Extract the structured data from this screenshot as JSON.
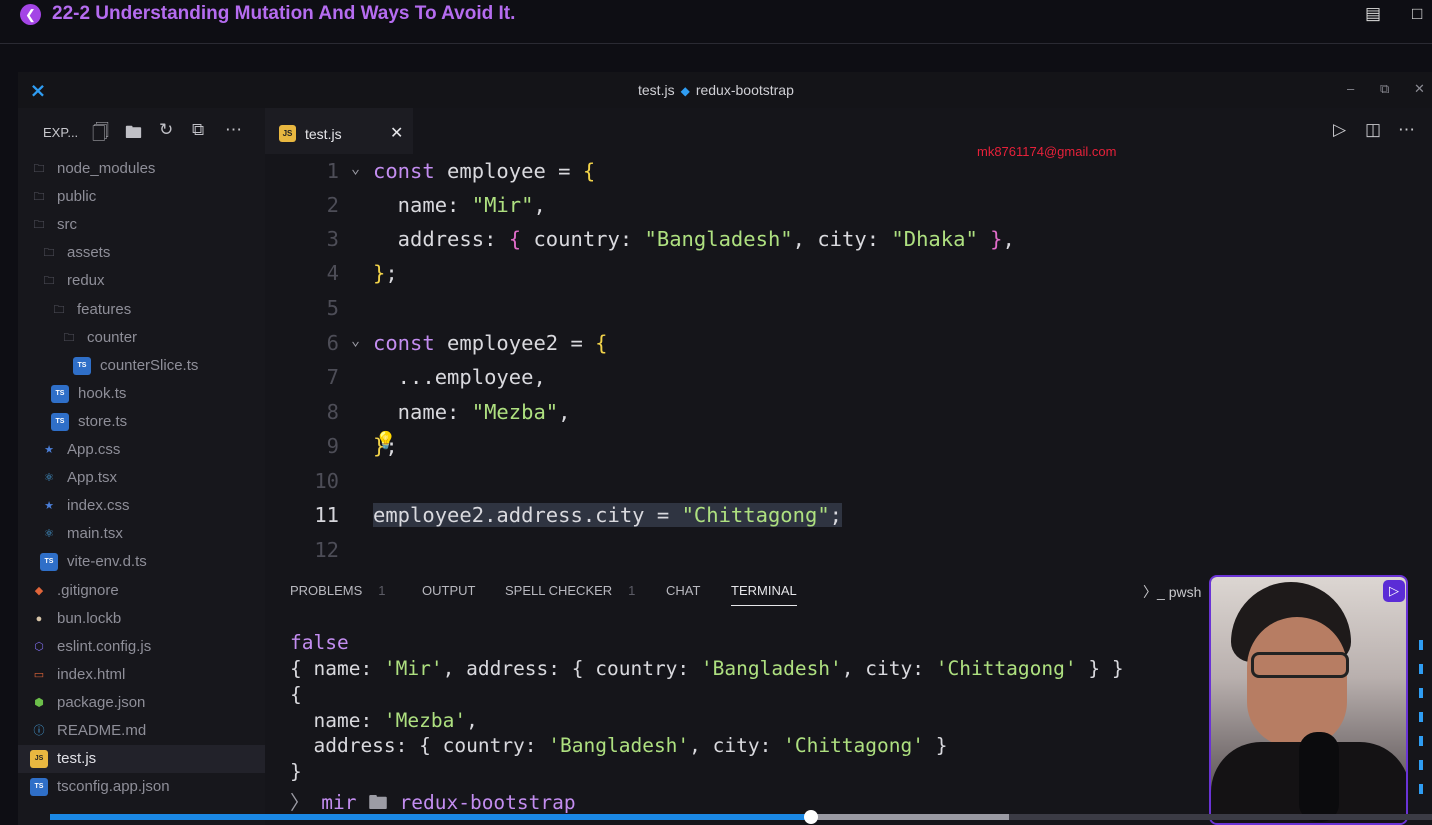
{
  "video": {
    "title": "22-2 Understanding Mutation And Ways To Avoid It.",
    "progress_fraction": 0.551,
    "buffered_fraction": 0.694
  },
  "window": {
    "file": "test.js",
    "project": "redux-bootstrap"
  },
  "explorer": {
    "label": "EXP...",
    "items": [
      {
        "label": "node_modules",
        "icon": "folder-icon"
      },
      {
        "label": "public",
        "icon": "folder-icon"
      },
      {
        "label": "src",
        "icon": "folder-icon"
      },
      {
        "label": "assets",
        "icon": "folder-icon"
      },
      {
        "label": "redux",
        "icon": "folder-icon"
      },
      {
        "label": "features",
        "icon": "folder-icon"
      },
      {
        "label": "counter",
        "icon": "folder-icon"
      },
      {
        "label": "counterSlice.ts",
        "icon": "ts-icon"
      },
      {
        "label": "hook.ts",
        "icon": "ts-icon"
      },
      {
        "label": "store.ts",
        "icon": "ts-icon"
      },
      {
        "label": "App.css",
        "icon": "css-icon"
      },
      {
        "label": "App.tsx",
        "icon": "react-icon"
      },
      {
        "label": "index.css",
        "icon": "css-icon"
      },
      {
        "label": "main.tsx",
        "icon": "react-icon"
      },
      {
        "label": "vite-env.d.ts",
        "icon": "ts-icon"
      },
      {
        "label": ".gitignore",
        "icon": "git-icon"
      },
      {
        "label": "bun.lockb",
        "icon": "bun-icon"
      },
      {
        "label": "eslint.config.js",
        "icon": "eslint-icon"
      },
      {
        "label": "index.html",
        "icon": "html-icon"
      },
      {
        "label": "package.json",
        "icon": "node-icon"
      },
      {
        "label": "README.md",
        "icon": "info-icon"
      },
      {
        "label": "test.js",
        "icon": "js-icon"
      },
      {
        "label": "tsconfig.app.json",
        "icon": "ts-icon"
      }
    ]
  },
  "editor": {
    "tab_label": "test.js",
    "email": "mk8761174@gmail.com",
    "line_numbers": [
      "1",
      "2",
      "3",
      "4",
      "5",
      "6",
      "7",
      "8",
      "9",
      "10",
      "11",
      "12"
    ]
  },
  "panel": {
    "tabs": [
      {
        "label": "PROBLEMS",
        "count": "1"
      },
      {
        "label": "OUTPUT",
        "count": ""
      },
      {
        "label": "SPELL CHECKER",
        "count": "1"
      },
      {
        "label": "CHAT",
        "count": ""
      },
      {
        "label": "TERMINAL",
        "count": ""
      }
    ],
    "shell": "pwsh",
    "prompt_user": "mir",
    "prompt_dir": "redux-bootstrap"
  },
  "colors": {
    "accent": "#b56cf0",
    "keyword": "#c38df0",
    "string": "#aee080",
    "bracket": "#f2d34a",
    "email": "#e6213a",
    "progress": "#1a88e5"
  }
}
